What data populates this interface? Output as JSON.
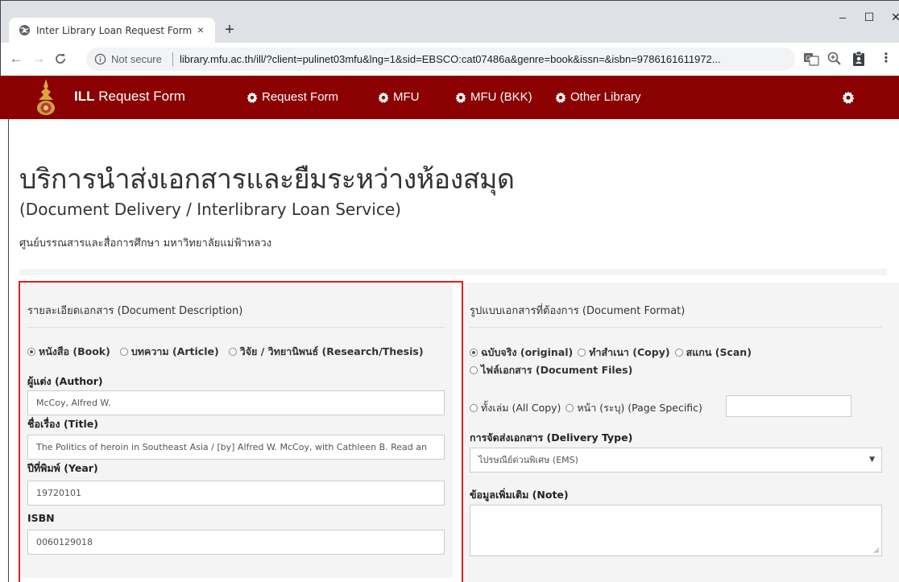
{
  "browser": {
    "tab_title": "Inter Library Loan Request Form",
    "tab_close": "×",
    "new_tab": "+",
    "not_secure": "Not secure",
    "url": "library.mfu.ac.th/ill/?client=pulinet03mfu&lng=1&sid=EBSCO:cat07486a&genre=book&issn=&isbn=9786161611972...",
    "win_min": "–",
    "win_max": "☐",
    "win_close": "✕",
    "icons": [
      "back-arrow-icon",
      "forward-arrow-icon",
      "reload-icon",
      "info-icon",
      "translate-icon",
      "zoom-icon",
      "clipboard-icon",
      "menu-icon"
    ]
  },
  "navbar": {
    "brand_bold": "ILL",
    "brand_rest": " Request Form",
    "items": [
      {
        "label": "Request Form"
      },
      {
        "label": "MFU"
      },
      {
        "label": "MFU (BKK)"
      },
      {
        "label": "Other Library"
      }
    ]
  },
  "header": {
    "title": "บริการนำส่งเอกสารและยืมระหว่างห้องสมุด",
    "subtitle": "(Document Delivery / Interlibrary Loan Service)",
    "organization": "ศูนย์บรรณสารและสื่อการศึกษา มหาวิทยาลัยแม่ฟ้าหลวง"
  },
  "document_description": {
    "heading": "รายละเอียดเอกสาร (Document Description)",
    "types": [
      {
        "label": "หนังสือ (Book)",
        "selected": true
      },
      {
        "label": "บทความ (Article)",
        "selected": false
      },
      {
        "label": "วิจัย / วิทยานิพนธ์ (Research/Thesis)",
        "selected": false
      }
    ],
    "author_label": "ผู้แต่ง (Author)",
    "author_value": "McCoy, Alfred W.",
    "title_label": "ชื่อเรื่อง (Title)",
    "title_value": "The Politics of heroin in Southeast Asia / [by] Alfred W. McCoy, with Cathleen B. Read an",
    "year_label": "ปีที่พิมพ์ (Year)",
    "year_value": "19720101",
    "isbn_label": "ISBN",
    "isbn_value": "0060129018"
  },
  "document_format": {
    "heading": "รูปแบบเอกสารที่ต้องการ (Document Format)",
    "formats": [
      {
        "label": "ฉบับจริง (original)",
        "selected": true
      },
      {
        "label": "ทำสำเนา (Copy)",
        "selected": false
      },
      {
        "label": "สแกน (Scan)",
        "selected": false
      }
    ],
    "files_option": "ไฟล์เอกสาร (Document Files)",
    "all_copy": "ทั้งเล่ม (All Copy)",
    "page_specific": "หน้า (ระบุ) (Page Specific)",
    "page_value": "",
    "delivery_label": "การจัดส่งเอกสาร (Delivery Type)",
    "delivery_value": "ไปรษณีย์ด่วนพิเศษ (EMS)",
    "note_label": "ข้อมูลเพิ่มเติม (Note)",
    "note_value": ""
  },
  "colors": {
    "navbar": "#8b0000",
    "highlight": "#e02020",
    "panel": "#f4f4f4"
  }
}
